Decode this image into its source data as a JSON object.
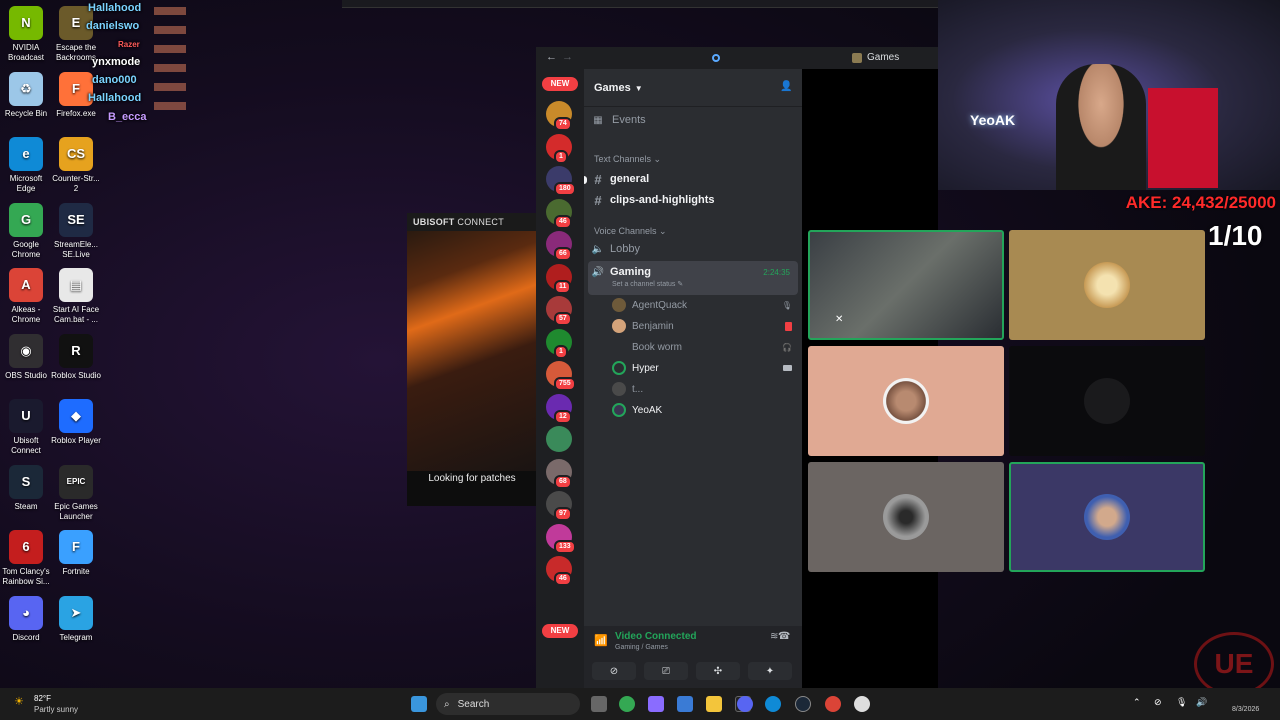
{
  "desktop": {
    "icons": [
      {
        "label": "NVIDIA Broadcast",
        "color": "#76b900",
        "glyph": "N"
      },
      {
        "label": "Escape the Backrooms",
        "color": "#6b5a2a",
        "glyph": "E"
      },
      {
        "label": "Recycle Bin",
        "color": "#9cc7e8",
        "glyph": "♻"
      },
      {
        "label": "Firefox.exe",
        "color": "#ff7139",
        "glyph": "F"
      },
      {
        "label": "Microsoft Edge",
        "color": "#0f8ad6",
        "glyph": "e"
      },
      {
        "label": "Counter-Str... 2",
        "color": "#e6a21e",
        "glyph": "CS"
      },
      {
        "label": "Google Chrome",
        "color": "#34a853",
        "glyph": "G"
      },
      {
        "label": "StreamEle... SE.Live",
        "color": "#1f2a44",
        "glyph": "SE"
      },
      {
        "label": "Alkeas - Chrome",
        "color": "#db4437",
        "glyph": "A"
      },
      {
        "label": "Start AI Face Cam.bat - ...",
        "color": "#e8e8e8",
        "glyph": "▤"
      },
      {
        "label": "OBS Studio",
        "color": "#302e31",
        "glyph": "◉"
      },
      {
        "label": "Roblox Studio",
        "color": "#111111",
        "glyph": "R"
      },
      {
        "label": "Ubisoft Connect",
        "color": "#1a1a2e",
        "glyph": "U"
      },
      {
        "label": "Roblox Player",
        "color": "#1e6cff",
        "glyph": "◆"
      },
      {
        "label": "Steam",
        "color": "#1b2838",
        "glyph": "S"
      },
      {
        "label": "Epic Games Launcher",
        "color": "#2a2a2a",
        "glyph": "EPIC"
      },
      {
        "label": "Tom Clancy's Rainbow Si...",
        "color": "#c41e1e",
        "glyph": "6"
      },
      {
        "label": "Fortnite",
        "color": "#3aa0ff",
        "glyph": "F"
      },
      {
        "label": "Discord",
        "color": "#5865f2",
        "glyph": "◕"
      },
      {
        "label": "Telegram",
        "color": "#2aa3e3",
        "glyph": "➤"
      }
    ]
  },
  "stream_chat": {
    "names": [
      "Hallahood",
      "danielswo",
      "ynxmode",
      "dano000",
      "Hallahood",
      "B_ecca"
    ],
    "razer": "Razer"
  },
  "ubisoft": {
    "brand": "UBISOFT",
    "connect": "CONNECT",
    "status": "Looking for patches"
  },
  "discord": {
    "server_title": "Games",
    "header_label": "Games",
    "events": "Events",
    "new_badge": "NEW",
    "server_badges": [
      "74",
      "1",
      "180",
      "46",
      "66",
      "11",
      "57",
      "1",
      "755",
      "12",
      "",
      "68",
      "97",
      "133",
      "46"
    ],
    "text_category": "Text Channels",
    "text_channels": [
      "general",
      "clips-and-highlights"
    ],
    "voice_category": "Voice Channels",
    "voice_channels": [
      "Lobby",
      "Gaming"
    ],
    "voice_timer": "2:24:35",
    "channel_status": "Set a channel status",
    "voice_users": [
      "AgentQuack",
      "Benjamin",
      "Book worm",
      "Hyper",
      "t...",
      "YeoAK"
    ],
    "connection_status": "Video Connected",
    "connection_channel": "Gaming / Games"
  },
  "overlay": {
    "counter": "AKE: 24,432/25000",
    "ratio": "1/10",
    "cam_sign": "YeoAK"
  },
  "taskbar": {
    "weather_temp": "82°F",
    "weather_desc": "Partly sunny",
    "search": "Search",
    "date": "8/3/2026"
  }
}
